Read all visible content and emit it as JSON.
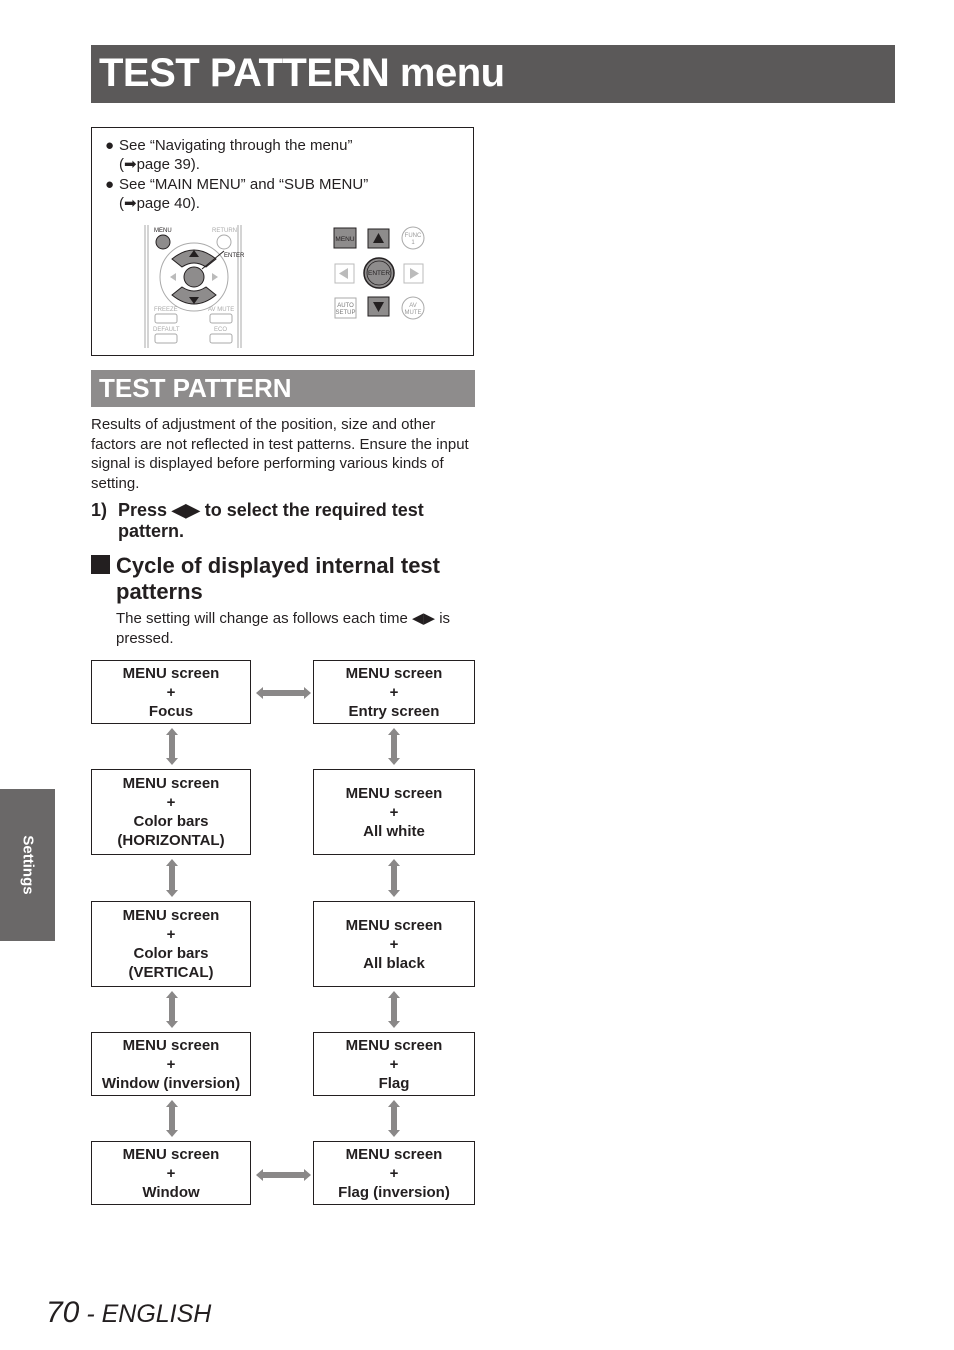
{
  "header": {
    "title": "TEST PATTERN menu"
  },
  "notes": {
    "items": [
      {
        "line1": "See “Navigating through the menu”",
        "line2": "(➡page 39)."
      },
      {
        "line1": "See “MAIN MENU” and “SUB MENU”",
        "line2": "(➡page 40)."
      }
    ],
    "remote": {
      "menu": "MENU",
      "return": "RETURN",
      "enter": "ENTER",
      "freeze": "FREEZE",
      "av_mute": "AV MUTE",
      "default": "DEFAULT",
      "eco": "ECO"
    },
    "panel": {
      "menu": "MENU",
      "func_1": "FUNC",
      "func_2": "1",
      "enter": "ENTER",
      "auto_1": "AUTO",
      "auto_2": "SETUP",
      "av_1": "AV",
      "av_2": "MUTE"
    }
  },
  "section": {
    "title": "TEST PATTERN",
    "body": "Results of adjustment of the position, size and other factors are not reflected in test patterns. Ensure the input signal is displayed before performing various kinds of setting.",
    "step_number": "1)",
    "step_text": "Press ◀▶ to select the required test pattern.",
    "sub_heading": "Cycle of displayed internal test patterns",
    "sub_desc": "The setting will change as follows each time ◀▶ is pressed."
  },
  "flow": {
    "plus": "+",
    "left": [
      {
        "l1": "MENU screen",
        "l3": "Focus"
      },
      {
        "l1": "MENU screen",
        "l3": "Color bars",
        "l4": "(HORIZONTAL)"
      },
      {
        "l1": "MENU screen",
        "l3": "Color bars",
        "l4": "(VERTICAL)"
      },
      {
        "l1": "MENU screen",
        "l3": "Window (inversion)"
      },
      {
        "l1": "MENU screen",
        "l3": "Window"
      }
    ],
    "right": [
      {
        "l1": "MENU screen",
        "l3": "Entry screen"
      },
      {
        "l1": "MENU screen",
        "l3": "All white"
      },
      {
        "l1": "MENU screen",
        "l3": "All black"
      },
      {
        "l1": "MENU screen",
        "l3": "Flag"
      },
      {
        "l1": "MENU screen",
        "l3": "Flag (inversion)"
      }
    ]
  },
  "side_tab": {
    "label": "Settings"
  },
  "footer": {
    "page_number": "70",
    "language": " - ENGLISH"
  },
  "colors": {
    "title_bar": "#5b5959",
    "section_bar": "#8e8c8c",
    "arrow": "#8a8888",
    "side_tab": "#6a6868"
  }
}
